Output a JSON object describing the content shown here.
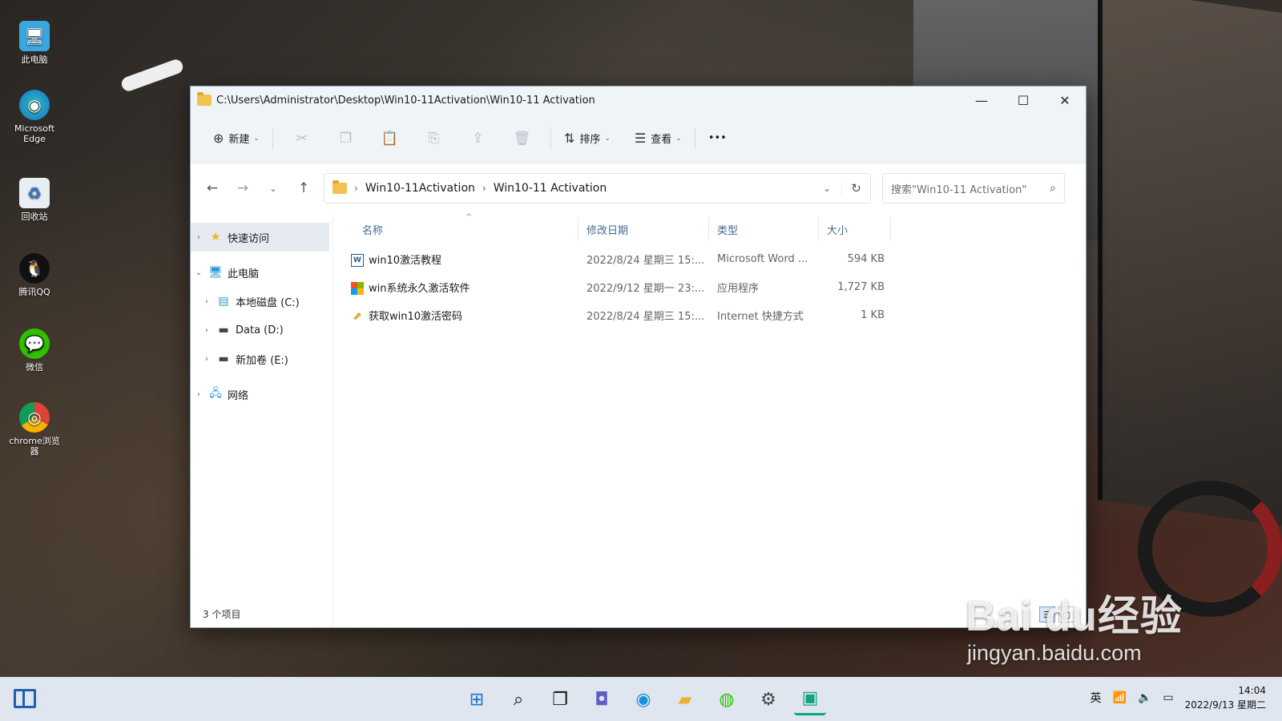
{
  "desktop": {
    "icons": [
      {
        "label": "此电脑",
        "glyph": "🖥"
      },
      {
        "label": "Microsoft Edge",
        "glyph": "◉"
      },
      {
        "label": "回收站",
        "glyph": "♻"
      },
      {
        "label": "腾讯QQ",
        "glyph": "🐧"
      },
      {
        "label": "微信",
        "glyph": "💬"
      },
      {
        "label": "chrome浏览器",
        "glyph": "◎"
      }
    ]
  },
  "window": {
    "title": "C:\\Users\\Administrator\\Desktop\\Win10-11Activation\\Win10-11 Activation",
    "controls": {
      "minimize": "—",
      "maximize": "☐",
      "close": "✕"
    }
  },
  "toolbar": {
    "new_label": "新建",
    "sort_label": "排序",
    "view_label": "查看",
    "more_label": "•••"
  },
  "nav": {
    "breadcrumbs": [
      "Win10-11Activation",
      "Win10-11 Activation"
    ],
    "search_placeholder": "搜索\"Win10-11 Activation\""
  },
  "tree": {
    "quick_access": "快速访问",
    "this_pc": "此电脑",
    "drive_c": "本地磁盘 (C:)",
    "drive_d": "Data (D:)",
    "drive_e": "新加卷 (E:)",
    "network": "网络"
  },
  "columns": {
    "name": "名称",
    "date": "修改日期",
    "type": "类型",
    "size": "大小"
  },
  "files": [
    {
      "name": "win10激活教程",
      "date": "2022/8/24 星期三 15:...",
      "type": "Microsoft Word ...",
      "size": "594 KB",
      "icon": "word-doc-icon"
    },
    {
      "name": "win系统永久激活软件",
      "date": "2022/9/12 星期一 23:...",
      "type": "应用程序",
      "size": "1,727 KB",
      "icon": "application-icon"
    },
    {
      "name": "获取win10激活密码",
      "date": "2022/8/24 星期三 15:...",
      "type": "Internet 快捷方式",
      "size": "1 KB",
      "icon": "internet-shortcut-icon"
    }
  ],
  "status": {
    "item_count": "3 个项目"
  },
  "watermark": {
    "brand": "Bai du经验",
    "url": "jingyan.baidu.com"
  },
  "taskbar": {
    "apps": [
      "start-icon",
      "search-icon",
      "task-view-icon",
      "chat-icon",
      "edge-icon",
      "file-explorer-icon",
      "wechat-icon",
      "settings-icon",
      "photos-icon"
    ],
    "ime": "英",
    "time": "14:04",
    "date": "2022/9/13 星期二"
  }
}
